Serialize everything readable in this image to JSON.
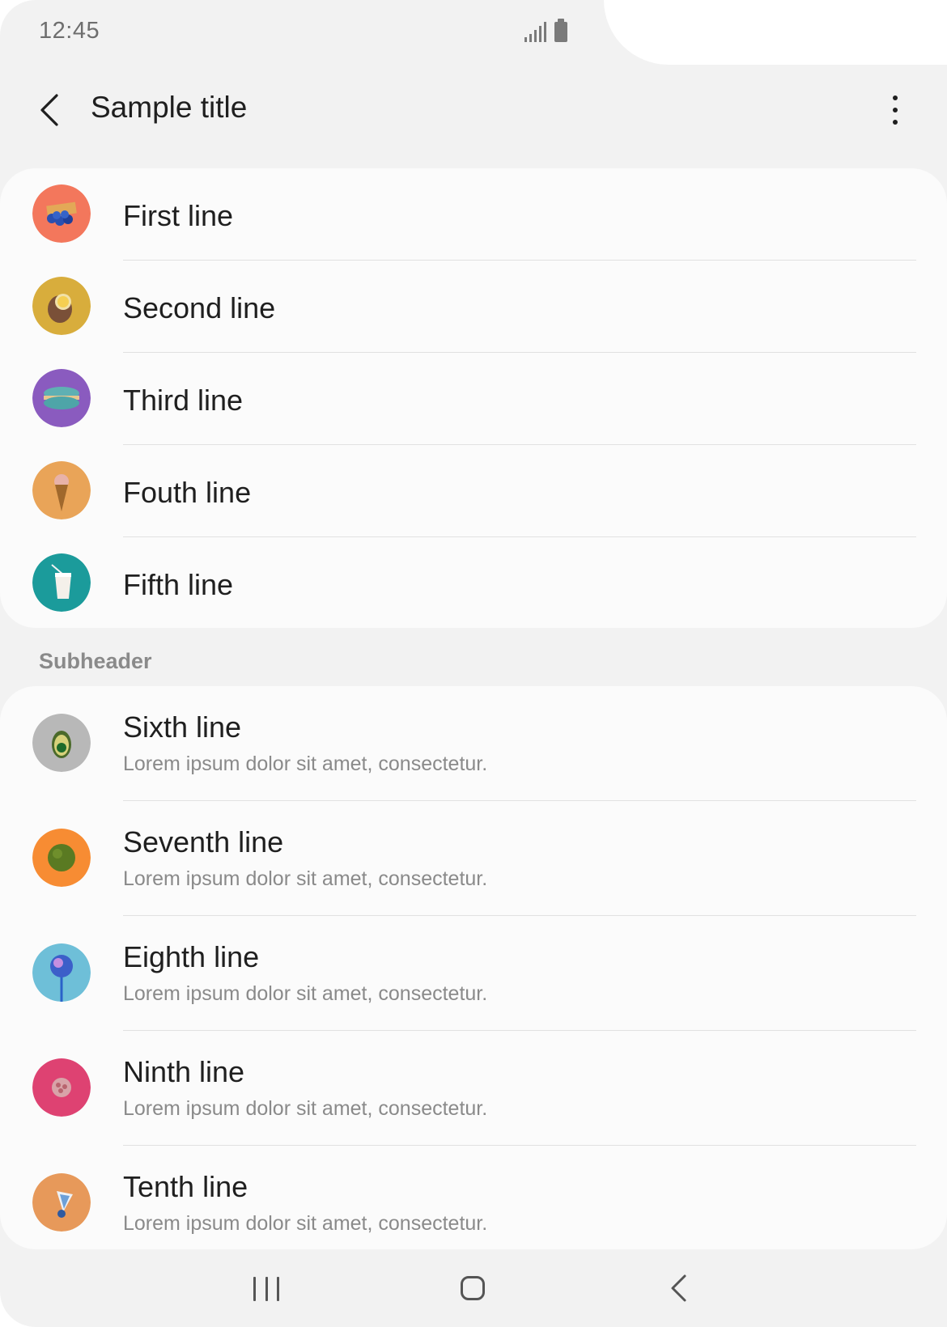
{
  "status_bar": {
    "time": "12:45"
  },
  "app_bar": {
    "title": "Sample title",
    "back_icon": "chevron-left-icon",
    "more_icon": "more-vertical-icon"
  },
  "list_group_1": {
    "items": [
      {
        "title": "First line",
        "icon": "blueberries-basket-icon",
        "color": "#f3775c"
      },
      {
        "title": "Second line",
        "icon": "coconut-icon",
        "color": "#d8ad3c"
      },
      {
        "title": "Third line",
        "icon": "macaron-icon",
        "color": "#8a5bbf"
      },
      {
        "title": "Fouth line",
        "icon": "ice-cream-cone-icon",
        "color": "#e9a458"
      },
      {
        "title": "Fifth line",
        "icon": "cup-with-straw-icon",
        "color": "#1b9b9b"
      }
    ]
  },
  "subheader": "Subheader",
  "list_group_2": {
    "items": [
      {
        "title": "Sixth line",
        "subtitle": "Lorem ipsum dolor sit amet, consectetur.",
        "icon": "avocado-icon",
        "color": "#b8b8b8"
      },
      {
        "title": "Seventh line",
        "subtitle": "Lorem ipsum dolor sit amet, consectetur.",
        "icon": "moss-ball-icon",
        "color": "#f78c33"
      },
      {
        "title": "Eighth line",
        "subtitle": "Lorem ipsum dolor sit amet, consectetur.",
        "icon": "lollipop-icon",
        "color": "#6ebfd8"
      },
      {
        "title": "Ninth line",
        "subtitle": "Lorem ipsum dolor sit amet, consectetur.",
        "icon": "raspberry-icon",
        "color": "#de4272"
      },
      {
        "title": "Tenth line",
        "subtitle": "Lorem ipsum dolor sit amet, consectetur.",
        "icon": "shuttlecock-icon",
        "color": "#e7995a"
      }
    ]
  },
  "nav_bar": {
    "recent_icon": "recent-apps-icon",
    "home_icon": "home-icon",
    "back_icon": "back-icon"
  }
}
